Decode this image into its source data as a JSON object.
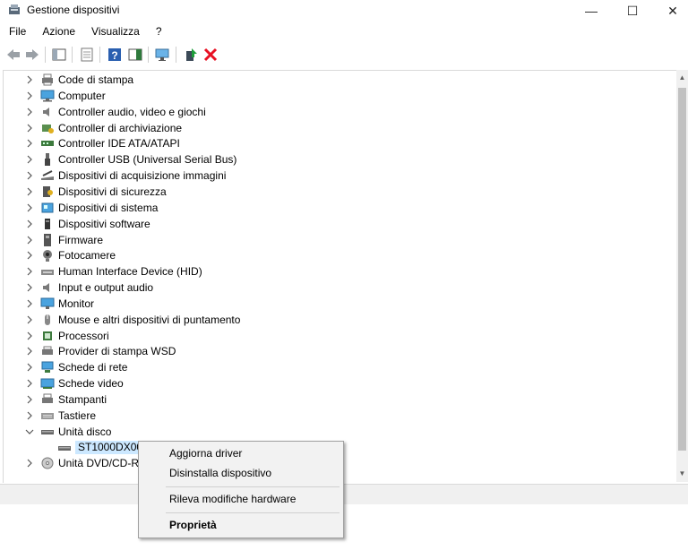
{
  "window": {
    "title": "Gestione dispositivi",
    "controls": {
      "minimize": "—",
      "maximize": "☐",
      "close": "✕"
    }
  },
  "menubar": [
    "File",
    "Azione",
    "Visualizza",
    "?"
  ],
  "toolbar": [
    "back-icon",
    "forward-icon",
    "console-tree-icon",
    "properties-icon",
    "help-icon",
    "action-pane-icon",
    "monitor-scan-icon",
    "update-driver-icon",
    "uninstall-icon"
  ],
  "tree": {
    "categories": [
      {
        "label": "Code di stampa",
        "icon": "print-queue-icon"
      },
      {
        "label": "Computer",
        "icon": "computer-icon"
      },
      {
        "label": "Controller audio, video e giochi",
        "icon": "speaker-icon"
      },
      {
        "label": "Controller di archiviazione",
        "icon": "storage-controller-icon"
      },
      {
        "label": "Controller IDE ATA/ATAPI",
        "icon": "ide-controller-icon"
      },
      {
        "label": "Controller USB (Universal Serial Bus)",
        "icon": "usb-icon"
      },
      {
        "label": "Dispositivi di acquisizione immagini",
        "icon": "scanner-icon"
      },
      {
        "label": "Dispositivi di sicurezza",
        "icon": "security-device-icon"
      },
      {
        "label": "Dispositivi di sistema",
        "icon": "system-device-icon"
      },
      {
        "label": "Dispositivi software",
        "icon": "software-device-icon"
      },
      {
        "label": "Firmware",
        "icon": "firmware-icon"
      },
      {
        "label": "Fotocamere",
        "icon": "camera-icon"
      },
      {
        "label": "Human Interface Device (HID)",
        "icon": "hid-icon"
      },
      {
        "label": "Input e output audio",
        "icon": "speaker-icon"
      },
      {
        "label": "Monitor",
        "icon": "monitor-icon"
      },
      {
        "label": "Mouse e altri dispositivi di puntamento",
        "icon": "mouse-icon"
      },
      {
        "label": "Processori",
        "icon": "processor-icon"
      },
      {
        "label": "Provider di stampa WSD",
        "icon": "wsd-printer-icon"
      },
      {
        "label": "Schede di rete",
        "icon": "network-adapter-icon"
      },
      {
        "label": "Schede video",
        "icon": "display-adapter-icon"
      },
      {
        "label": "Stampanti",
        "icon": "printer-icon"
      },
      {
        "label": "Tastiere",
        "icon": "keyboard-icon"
      },
      {
        "label": "Unità disco",
        "icon": "disk-drive-icon",
        "expanded": true
      },
      {
        "label": "Unità DVD/CD-ROM",
        "icon": "dvd-drive-icon"
      }
    ],
    "selected_child": {
      "label": "ST1000DX001-",
      "icon": "disk-drive-icon"
    }
  },
  "context_menu": {
    "items": [
      "Aggiorna driver",
      "Disinstalla dispositivo",
      "Rileva modifiche hardware",
      "Proprietà"
    ]
  },
  "colors": {
    "selection": "#cce8ff",
    "uninstall_red": "#e81123",
    "update_green": "#1e9e3a"
  }
}
